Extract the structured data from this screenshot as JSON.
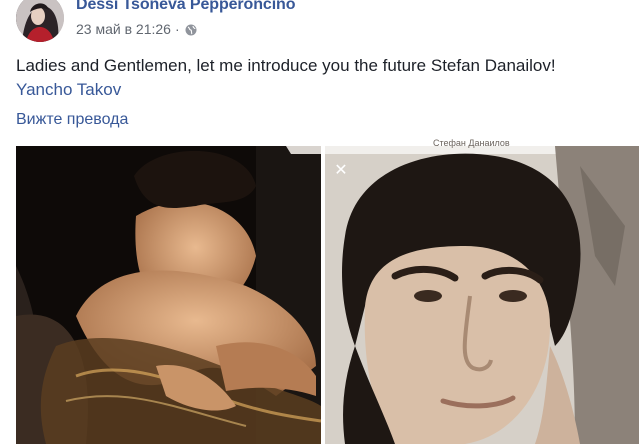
{
  "post": {
    "author": "Dessi Tsoneva Pepperoncino",
    "date": "23 май в 21:26",
    "separator": "·",
    "privacy_icon": "globe-icon",
    "text": "Ladies and Gentlemen, let me introduce you the future Stefan Danailov!",
    "mention": "Yancho Takov",
    "translate_label": "Вижте превода"
  },
  "photos": {
    "close_icon": "close-icon",
    "right_caption": "Стефан Данаилов"
  }
}
